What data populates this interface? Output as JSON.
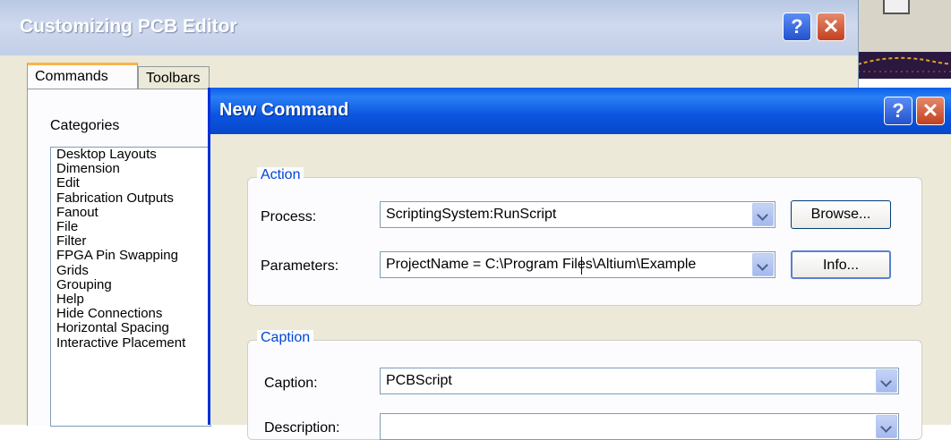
{
  "customizing_dialog": {
    "title": "Customizing PCB Editor",
    "help_glyph": "?",
    "close_glyph": "✕",
    "tabs": [
      {
        "label": "Commands"
      },
      {
        "label": "Toolbars"
      }
    ],
    "categories_label": "Categories",
    "categories": [
      "Desktop Layouts",
      "Dimension",
      "Edit",
      "Fabrication Outputs",
      "Fanout",
      "File",
      "Filter",
      "FPGA Pin Swapping",
      "Grids",
      "Grouping",
      "Help",
      "Hide Connections",
      "Horizontal Spacing",
      "Interactive Placement"
    ]
  },
  "new_command_dialog": {
    "title": "New Command",
    "help_glyph": "?",
    "close_glyph": "✕",
    "action_group": {
      "legend": "Action",
      "process_label": "Process:",
      "process_value": "ScriptingSystem:RunScript",
      "browse_button": "Browse...",
      "parameters_label": "Parameters:",
      "parameters_value": "ProjectName = C:\\Program Files\\Altium\\Example",
      "info_button": "Info..."
    },
    "caption_group": {
      "legend": "Caption",
      "caption_label": "Caption:",
      "caption_value": "PCBScript",
      "description_label": "Description:",
      "description_value": ""
    }
  },
  "colors": {
    "xp_title_active": "#0a55df",
    "xp_title_inactive": "#b9c8e4",
    "legend_blue": "#0046d5",
    "dialog_face": "#ece9d8"
  }
}
